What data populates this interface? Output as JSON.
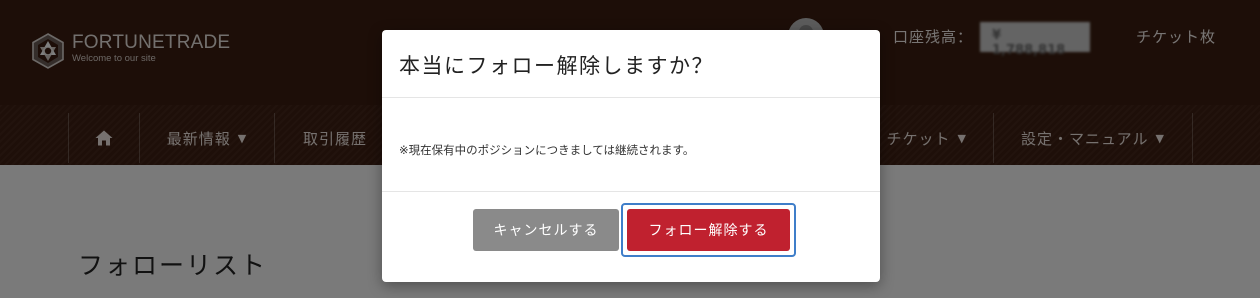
{
  "brand": {
    "name": "FORTUNETRADE",
    "tagline": "Welcome to our site"
  },
  "header": {
    "balance_label": "口座残高：",
    "balance_value": "¥ 1,788,818",
    "ticket_label": "チケット枚"
  },
  "nav": {
    "home_icon": "home-icon",
    "items": [
      {
        "label": "最新情報",
        "has_dropdown": true
      },
      {
        "label": "取引履歴",
        "has_dropdown": false
      },
      {
        "label": "チケット",
        "has_dropdown": true
      },
      {
        "label": "設定・マニュアル",
        "has_dropdown": true
      }
    ]
  },
  "page": {
    "title": "フォローリスト"
  },
  "modal": {
    "title": "本当にフォロー解除しますか？",
    "message": "※現在保有中のポジションにつきましては継続されます。",
    "cancel_label": "キャンセルする",
    "confirm_label": "フォロー解除する"
  },
  "colors": {
    "header_bg": "#3a1d10",
    "confirm": "#c0212f",
    "cancel": "#8a8a8a",
    "focus_ring": "#3f7ec9"
  }
}
